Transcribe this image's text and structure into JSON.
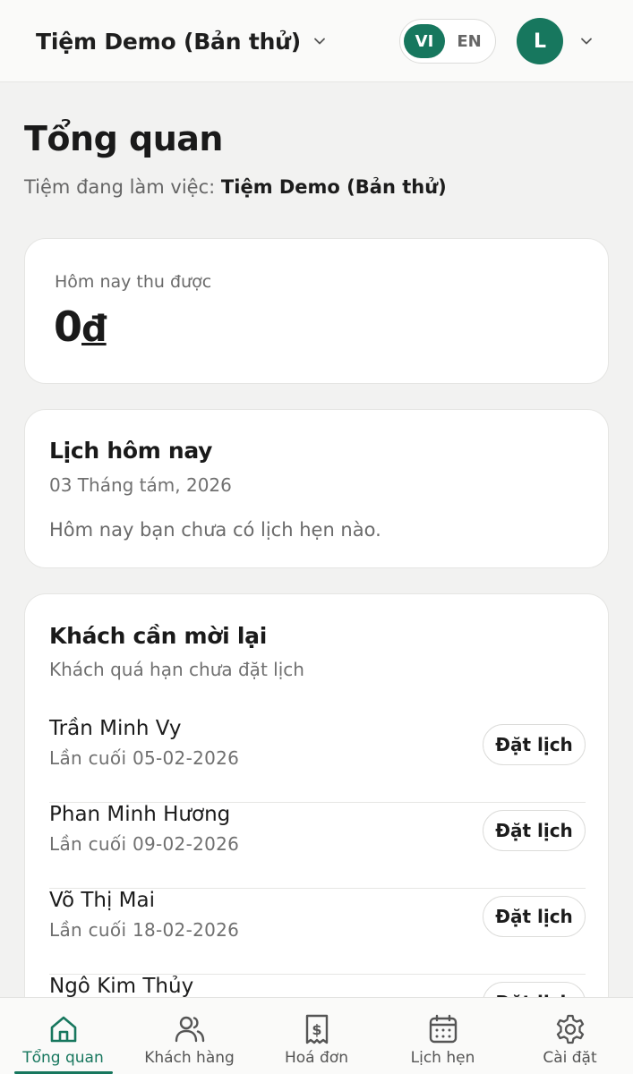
{
  "header": {
    "shop_name": "Tiệm Demo (Bản thử)",
    "lang_vi": "VI",
    "lang_en": "EN",
    "avatar_initial": "L",
    "accent_color": "#17775e"
  },
  "page": {
    "title": "Tổng quan",
    "workspace_label": "Tiệm đang làm việc:",
    "workspace_name": "Tiệm Demo (Bản thử)"
  },
  "revenue": {
    "label": "Hôm nay thu được",
    "amount": "0",
    "currency": "đ"
  },
  "schedule": {
    "title": "Lịch hôm nay",
    "date": "03 Tháng tám, 2026",
    "empty_message": "Hôm nay bạn chưa có lịch hẹn nào."
  },
  "reinvite": {
    "title": "Khách cần mời lại",
    "subtitle": "Khách quá hạn chưa đặt lịch",
    "book_label": "Đặt lịch",
    "customers": [
      {
        "name": "Trần Minh Vy",
        "last": "Lần cuối 05-02-2026"
      },
      {
        "name": "Phan Minh Hương",
        "last": "Lần cuối 09-02-2026"
      },
      {
        "name": "Võ Thị Mai",
        "last": "Lần cuối 18-02-2026"
      },
      {
        "name": "Ngô Kim Thủy",
        "last": ""
      }
    ]
  },
  "nav": {
    "items": [
      {
        "label": "Tổng quan",
        "icon": "home-icon",
        "active": true
      },
      {
        "label": "Khách hàng",
        "icon": "users-icon",
        "active": false
      },
      {
        "label": "Hoá đơn",
        "icon": "receipt-icon",
        "active": false
      },
      {
        "label": "Lịch hẹn",
        "icon": "calendar-icon",
        "active": false
      },
      {
        "label": "Cài đặt",
        "icon": "gear-icon",
        "active": false
      }
    ]
  }
}
